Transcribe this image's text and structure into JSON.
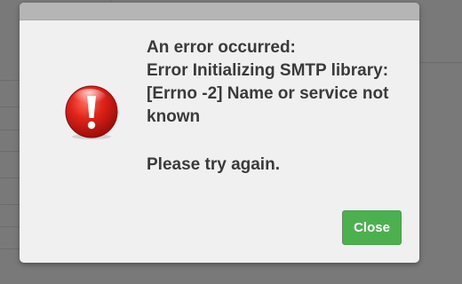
{
  "dialog": {
    "icon": "exclamation-error-icon",
    "message_lines": [
      "An error occurred:",
      "Error Initializing SMTP library:",
      "[Errno -2] Name or service not",
      "known"
    ],
    "retry_text": "Please try again.",
    "close_label": "Close"
  },
  "colors": {
    "button": "#4cb04f",
    "icon_red": "#d0150f",
    "dialog_bg": "#f0f0f0",
    "backdrop": "#797979"
  }
}
